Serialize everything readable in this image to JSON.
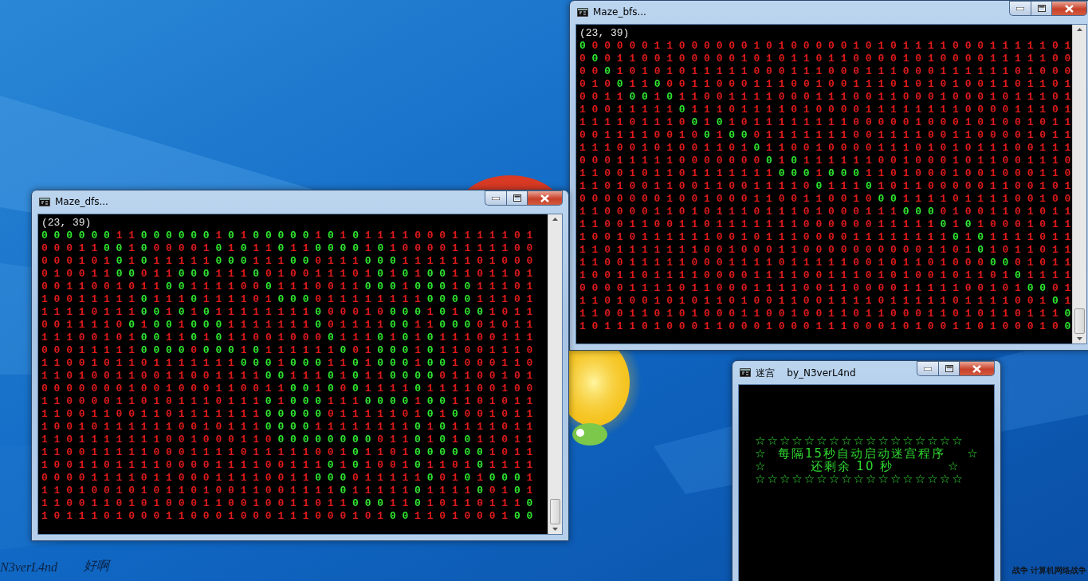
{
  "windows": [
    {
      "kind": "maze",
      "title": "Maze_bfs...",
      "header": "(23, 39)",
      "rows": [
        {
          "segments": [
            {
              "text": "0 ",
              "path": true
            },
            {
              "text": "0 0 0 0 0 1 1 0 0 0 0 0 0 1 0 1 0 0 0 0 0 1 0 1 0 1 1 1 1 0 0 0 1 1 1 1 1 0 1",
              "path": false
            }
          ]
        },
        {
          "segments": [
            {
              "text": "0 ",
              "path": false
            },
            {
              "text": "0 ",
              "path": true
            },
            {
              "text": "0 1 1 0 0 1 0 0 0 0 0 1 0 1 0 1 1 0 1 1 0 0 0 0 1 0 1 0 0 0 0 1 1 1 1 1 0 0",
              "path": false
            }
          ]
        },
        {
          "segments": [
            {
              "text": "0 0 ",
              "path": false
            },
            {
              "text": "0 ",
              "path": true
            },
            {
              "text": "1 0 1 0 1 0 1 1 1 1 1 0 0 0 1 1 1 0 0 0 1 1 1 0 0 0 1 1 1 1 1 1 0 1 0 0 0",
              "path": false
            }
          ]
        },
        {
          "segments": [
            {
              "text": "0 1 0 ",
              "path": false
            },
            {
              "text": "0 ",
              "path": true
            },
            {
              "text": "1 1 ",
              "path": false
            },
            {
              "text": "0 ",
              "path": true
            },
            {
              "text": "0 0 1 1 0 0 0 1 1 1 0 0 1 0 0 1 1 1 0 1 0 1 0 1 0 0 1 1 0 1 1 0 1",
              "path": false
            }
          ]
        },
        {
          "segments": [
            {
              "text": "0 0 1 1 ",
              "path": false
            },
            {
              "text": "0 0 ",
              "path": true
            },
            {
              "text": "1 ",
              "path": false
            },
            {
              "text": "0 ",
              "path": true
            },
            {
              "text": "1 1 0 0 1 1 1 1 0 0 0 1 1 1 0 0 1 1 0 0 0 1 0 0 0 1 0 1 1 1 0 1",
              "path": false
            }
          ]
        },
        {
          "segments": [
            {
              "text": "1 0 0 1 1 1 1 1 ",
              "path": false
            },
            {
              "text": "0 ",
              "path": true
            },
            {
              "text": "1 1 1 0 1 1 1 1 0 1 0 0 0 0 1 1 1 1 1 1 1 1 0 0 0 0 1 1 1 0 1",
              "path": false
            }
          ]
        },
        {
          "segments": [
            {
              "text": "1 1 1 1 0 1 1 1 0 ",
              "path": false
            },
            {
              "text": "0 ",
              "path": true
            },
            {
              "text": "1 ",
              "path": false
            },
            {
              "text": "0 ",
              "path": true
            },
            {
              "text": "1 0 1 1 1 1 1 1 1 1 0 0 0 0 0 1 0 0 0 1 0 1 0 0 1 0 1 1",
              "path": false
            }
          ]
        },
        {
          "segments": [
            {
              "text": "0 0 1 1 1 1 0 0 1 0 ",
              "path": false
            },
            {
              "text": "0 ",
              "path": true
            },
            {
              "text": "1 ",
              "path": false
            },
            {
              "text": "0 0 ",
              "path": true
            },
            {
              "text": "0 1 1 1 1 1 1 1 0 0 1 1 1 1 0 0 1 1 0 0 0 0 1 0 1 1",
              "path": false
            }
          ]
        },
        {
          "segments": [
            {
              "text": "1 1 1 0 0 1 0 1 0 0 1 1 0 1 ",
              "path": false
            },
            {
              "text": "0 ",
              "path": true
            },
            {
              "text": "1 1 0 0 1 0 0 0 0 1 1 1 0 1 0 1 0 1 1 1 0 0 1 1 1",
              "path": false
            }
          ]
        },
        {
          "segments": [
            {
              "text": "0 0 0 1 1 1 1 1 0 0 0 0 0 0 0 ",
              "path": false
            },
            {
              "text": "0 ",
              "path": true
            },
            {
              "text": "1 ",
              "path": false
            },
            {
              "text": "0 ",
              "path": true
            },
            {
              "text": "1 1 1 1 1 1 0 0 1 0 0 0 1 0 1 1 0 0 1 1 1 0",
              "path": false
            }
          ]
        },
        {
          "segments": [
            {
              "text": "1 1 0 0 1 0 1 1 0 1 1 1 1 1 1 1 ",
              "path": false
            },
            {
              "text": "0 0 0 ",
              "path": true
            },
            {
              "text": "1 ",
              "path": false
            },
            {
              "text": "0 0 0 ",
              "path": true
            },
            {
              "text": "1 1 0 1 0 0 0 1 0 0 1 0 0 0 1 1 0",
              "path": false
            }
          ]
        },
        {
          "segments": [
            {
              "text": "1 1 0 1 0 0 1 1 0 0 1 1 0 0 1 1 1 1 0 ",
              "path": false
            },
            {
              "text": "0 ",
              "path": true
            },
            {
              "text": "1 1 1 ",
              "path": false
            },
            {
              "text": "0 ",
              "path": true
            },
            {
              "text": "1 0 1 1 0 0 0 0 0 1 1 0 0 1 0 1",
              "path": false
            }
          ]
        },
        {
          "segments": [
            {
              "text": "0 0 0 0 0 0 0 1 0 0 1 0 0 0 1 1 0 0 1 1 0 0 1 0 ",
              "path": false
            },
            {
              "text": "0 0 ",
              "path": true
            },
            {
              "text": "1 1 1 1 0 1 1 1 1 0 0 1 0 0",
              "path": false
            }
          ]
        },
        {
          "segments": [
            {
              "text": "1 1 0 0 0 0 1 1 0 1 0 1 1 1 0 1 1 1 0 1 0 0 0 1 1 1 ",
              "path": false
            },
            {
              "text": "0 0 0 ",
              "path": true
            },
            {
              "text": "0 1 0 0 1 1 0 1 0 1 1",
              "path": false
            }
          ]
        },
        {
          "segments": [
            {
              "text": "1 1 0 0 1 1 0 0 1 1 0 1 1 1 1 1 1 1 0 0 0 0 0 0 1 1 1 1 1 ",
              "path": false
            },
            {
              "text": "0 ",
              "path": true
            },
            {
              "text": "1 ",
              "path": false
            },
            {
              "text": "0 ",
              "path": true
            },
            {
              "text": "1 0 0 0 1 0 1 1",
              "path": false
            }
          ]
        },
        {
          "segments": [
            {
              "text": "1 0 0 1 0 1 1 1 1 1 1 0 0 1 0 1 1 1 0 0 0 0 1 1 1 1 1 1 1 1 ",
              "path": false
            },
            {
              "text": "0 ",
              "path": true
            },
            {
              "text": "1 ",
              "path": false
            },
            {
              "text": "0 ",
              "path": true
            },
            {
              "text": "1 1 1 1 0 1 1",
              "path": false
            }
          ]
        },
        {
          "segments": [
            {
              "text": "1 1 0 1 1 1 1 1 1 1 0 0 1 0 0 0 1 1 0 0 0 0 0 0 0 0 0 0 1 1 0 1 ",
              "path": false
            },
            {
              "text": "0 ",
              "path": true
            },
            {
              "text": "1 0 1 1 0 1 1",
              "path": false
            }
          ]
        },
        {
          "segments": [
            {
              "text": "1 1 0 0 1 1 1 1 1 0 0 0 1 1 1 1 0 1 1 1 1 1 0 0 1 0 1 1 0 1 0 0 0 ",
              "path": false
            },
            {
              "text": "0 0 ",
              "path": true
            },
            {
              "text": "0 1 0 1 1",
              "path": false
            }
          ]
        },
        {
          "segments": [
            {
              "text": "1 0 0 1 1 0 1 1 1 1 0 0 0 0 1 1 1 1 0 0 1 1 1 0 1 0 1 0 0 1 0 1 1 0 1 ",
              "path": false
            },
            {
              "text": "0 ",
              "path": true
            },
            {
              "text": "1 1 1 1",
              "path": false
            }
          ]
        },
        {
          "segments": [
            {
              "text": "0 0 0 0 1 1 1 1 0 1 1 0 0 0 1 1 1 1 0 0 1 1 0 0 0 0 1 1 1 1 1 0 0 1 0 1 ",
              "path": false
            },
            {
              "text": "0 0 ",
              "path": true
            },
            {
              "text": "0 1",
              "path": false
            }
          ]
        },
        {
          "segments": [
            {
              "text": "1 1 0 1 0 0 1 0 1 0 1 1 0 1 0 0 1 1 0 0 1 1 1 1 0 1 1 1 1 1 0 1 1 1 1 0 0 1 ",
              "path": false
            },
            {
              "text": "0 ",
              "path": true
            },
            {
              "text": "1",
              "path": false
            }
          ]
        },
        {
          "segments": [
            {
              "text": "1 1 0 0 1 1 0 1 0 1 0 0 0 1 1 0 0 1 0 0 1 1 0 1 1 0 0 0 1 1 0 1 0 1 1 0 1 1 1 ",
              "path": false
            },
            {
              "text": "0",
              "path": true
            }
          ]
        },
        {
          "segments": [
            {
              "text": "1 0 1 1 1 0 1 0 0 0 1 1 0 0 0 1 0 0 0 1 1 1 0 0 0 1 0 1 0 0 1 1 0 1 0 0 0 1 0 ",
              "path": false
            },
            {
              "text": "0",
              "path": true
            }
          ]
        }
      ]
    },
    {
      "kind": "maze",
      "title": "Maze_dfs...",
      "header": "(23, 39)",
      "rows": [
        {
          "segments": [
            {
              "text": "0 0 0 0 0 0 ",
              "path": true
            },
            {
              "text": "1 1 ",
              "path": false
            },
            {
              "text": "0 0 0 0 0 0 ",
              "path": true
            },
            {
              "text": "1 ",
              "path": false
            },
            {
              "text": "0 ",
              "path": true
            },
            {
              "text": "1 ",
              "path": false
            },
            {
              "text": "0 0 0 0 0 ",
              "path": true
            },
            {
              "text": "1 ",
              "path": false
            },
            {
              "text": "0 ",
              "path": true
            },
            {
              "text": "1 ",
              "path": false
            },
            {
              "text": "0 ",
              "path": true
            },
            {
              "text": "1 1 1 1 0 0 0 1 1 1 1 1 0 1",
              "path": false
            }
          ]
        },
        {
          "segments": [
            {
              "text": "0 0 0 1 1 ",
              "path": false
            },
            {
              "text": "0 0 ",
              "path": true
            },
            {
              "text": "1 ",
              "path": false
            },
            {
              "text": "0 ",
              "path": true
            },
            {
              "text": "0 0 0 0 1 ",
              "path": false
            },
            {
              "text": "0 ",
              "path": true
            },
            {
              "text": "1 ",
              "path": false
            },
            {
              "text": "0 ",
              "path": true
            },
            {
              "text": "1 1 ",
              "path": false
            },
            {
              "text": "0 ",
              "path": true
            },
            {
              "text": "1 1 ",
              "path": false
            },
            {
              "text": "0 0 0 0 ",
              "path": true
            },
            {
              "text": "1 ",
              "path": false
            },
            {
              "text": "0 ",
              "path": true
            },
            {
              "text": "1 0 0 0 0 1 1 1 1 1 0 0",
              "path": false
            }
          ]
        },
        {
          "segments": [
            {
              "text": "0 0 0 1 0 1 ",
              "path": false
            },
            {
              "text": "0 ",
              "path": true
            },
            {
              "text": "1 ",
              "path": false
            },
            {
              "text": "0 ",
              "path": true
            },
            {
              "text": "1 1 1 1 1 ",
              "path": false
            },
            {
              "text": "0 0 0 ",
              "path": true
            },
            {
              "text": "1 1 1 ",
              "path": false
            },
            {
              "text": "0 0 ",
              "path": true
            },
            {
              "text": "0 1 1 1 ",
              "path": false
            },
            {
              "text": "0 0 0 ",
              "path": true
            },
            {
              "text": "1 1 1 1 1 1 0 1 0 0 0",
              "path": false
            }
          ]
        },
        {
          "segments": [
            {
              "text": "0 1 0 0 1 1 ",
              "path": false
            },
            {
              "text": "0 0 ",
              "path": true
            },
            {
              "text": "0 1 1 ",
              "path": false
            },
            {
              "text": "0 0 0 ",
              "path": true
            },
            {
              "text": "1 1 1 ",
              "path": false
            },
            {
              "text": "0 ",
              "path": true
            },
            {
              "text": "0 1 0 0 1 1 1 0 1 ",
              "path": false
            },
            {
              "text": "0 ",
              "path": true
            },
            {
              "text": "1 ",
              "path": false
            },
            {
              "text": "0 ",
              "path": true
            },
            {
              "text": "1 ",
              "path": false
            },
            {
              "text": "0 0 ",
              "path": true
            },
            {
              "text": "1 1 0 1 1 0 1",
              "path": false
            }
          ]
        },
        {
          "segments": [
            {
              "text": "0 0 1 1 0 0 1 0 1 1 ",
              "path": false
            },
            {
              "text": "0 0 ",
              "path": true
            },
            {
              "text": "1 1 1 1 0 0 ",
              "path": false
            },
            {
              "text": "0 ",
              "path": true
            },
            {
              "text": "1 1 1 0 0 1 1 ",
              "path": false
            },
            {
              "text": "0 0 0 ",
              "path": true
            },
            {
              "text": "1 ",
              "path": false
            },
            {
              "text": "0 0 0 ",
              "path": true
            },
            {
              "text": "1 ",
              "path": false
            },
            {
              "text": "0 ",
              "path": true
            },
            {
              "text": "1 1 1 0 1",
              "path": false
            }
          ]
        },
        {
          "segments": [
            {
              "text": "1 0 0 1 1 1 1 1 ",
              "path": false
            },
            {
              "text": "0 ",
              "path": true
            },
            {
              "text": "1 1 1 ",
              "path": false
            },
            {
              "text": "0 ",
              "path": true
            },
            {
              "text": "1 1 1 1 0 1 ",
              "path": false
            },
            {
              "text": "0 0 0 ",
              "path": true
            },
            {
              "text": "0 1 1 1 1 1 1 1 1 ",
              "path": false
            },
            {
              "text": "0 0 0 0 ",
              "path": true
            },
            {
              "text": "1 1 1 0 1",
              "path": false
            }
          ]
        },
        {
          "segments": [
            {
              "text": "1 1 1 1 0 1 1 1 ",
              "path": false
            },
            {
              "text": "0 0 ",
              "path": true
            },
            {
              "text": "1 ",
              "path": false
            },
            {
              "text": "0 ",
              "path": true
            },
            {
              "text": "1 ",
              "path": false
            },
            {
              "text": "0 ",
              "path": true
            },
            {
              "text": "1 1 1 1 1 1 1 1 ",
              "path": false
            },
            {
              "text": "0 ",
              "path": true
            },
            {
              "text": "0 0 0 1 0 ",
              "path": false
            },
            {
              "text": "0 0 0 ",
              "path": true
            },
            {
              "text": "1 ",
              "path": false
            },
            {
              "text": "0 ",
              "path": true
            },
            {
              "text": "1 ",
              "path": false
            },
            {
              "text": "0 0 ",
              "path": true
            },
            {
              "text": "1 0 1 1",
              "path": false
            }
          ]
        },
        {
          "segments": [
            {
              "text": "0 0 1 1 1 1 0 ",
              "path": false
            },
            {
              "text": "0 ",
              "path": true
            },
            {
              "text": "1 ",
              "path": false
            },
            {
              "text": "0 0 ",
              "path": true
            },
            {
              "text": "1 ",
              "path": false
            },
            {
              "text": "0 0 0 ",
              "path": true
            },
            {
              "text": "1 1 1 1 1 1 1 ",
              "path": false
            },
            {
              "text": "0 ",
              "path": true
            },
            {
              "text": "0 1 1 1 1 ",
              "path": false
            },
            {
              "text": "0 0 ",
              "path": true
            },
            {
              "text": "1 1 ",
              "path": false
            },
            {
              "text": "0 0 0 ",
              "path": true
            },
            {
              "text": "0 1 0 1 1",
              "path": false
            }
          ]
        },
        {
          "segments": [
            {
              "text": "1 1 1 0 0 1 0 1 ",
              "path": false
            },
            {
              "text": "0 0 ",
              "path": true
            },
            {
              "text": "1 1 ",
              "path": false
            },
            {
              "text": "0 ",
              "path": true
            },
            {
              "text": "1 ",
              "path": false
            },
            {
              "text": "0 ",
              "path": true
            },
            {
              "text": "1 1 0 0 1 0 0 0 ",
              "path": false
            },
            {
              "text": "0 ",
              "path": true
            },
            {
              "text": "1 1 1 ",
              "path": false
            },
            {
              "text": "0 ",
              "path": true
            },
            {
              "text": "1 ",
              "path": false
            },
            {
              "text": "0 ",
              "path": true
            },
            {
              "text": "1 ",
              "path": false
            },
            {
              "text": "0 ",
              "path": true
            },
            {
              "text": "1 1 1 0 0 1 1 1",
              "path": false
            }
          ]
        },
        {
          "segments": [
            {
              "text": "0 0 0 1 1 1 1 1 ",
              "path": false
            },
            {
              "text": "0 0 0 0 ",
              "path": true
            },
            {
              "text": "0 ",
              "path": false
            },
            {
              "text": "0 0 0 ",
              "path": true
            },
            {
              "text": "1 ",
              "path": false
            },
            {
              "text": "0 ",
              "path": true
            },
            {
              "text": "1 1 1 1 1 1 ",
              "path": false
            },
            {
              "text": "0 ",
              "path": true
            },
            {
              "text": "0 1 ",
              "path": false
            },
            {
              "text": "0 0 0 ",
              "path": true
            },
            {
              "text": "1 ",
              "path": false
            },
            {
              "text": "0 ",
              "path": true
            },
            {
              "text": "1 1 0 0 1 1 1 0",
              "path": false
            }
          ]
        },
        {
          "segments": [
            {
              "text": "1 1 0 0 1 0 1 1 0 1 1 1 1 1 1 1 ",
              "path": false
            },
            {
              "text": "0 0 0 ",
              "path": true
            },
            {
              "text": "1 ",
              "path": false
            },
            {
              "text": "0 0 0 ",
              "path": true
            },
            {
              "text": "1 1 ",
              "path": false
            },
            {
              "text": "0 ",
              "path": true
            },
            {
              "text": "1 ",
              "path": false
            },
            {
              "text": "0 0 0 ",
              "path": true
            },
            {
              "text": "1 ",
              "path": false
            },
            {
              "text": "0 0 ",
              "path": true
            },
            {
              "text": "1 0 0 0 1 1 0",
              "path": false
            }
          ]
        },
        {
          "segments": [
            {
              "text": "1 1 0 1 0 0 1 1 0 0 1 1 0 0 1 1 1 1 ",
              "path": false
            },
            {
              "text": "0 0 ",
              "path": true
            },
            {
              "text": "1 1 1 ",
              "path": false
            },
            {
              "text": "0 ",
              "path": true
            },
            {
              "text": "1 ",
              "path": false
            },
            {
              "text": "0 ",
              "path": true
            },
            {
              "text": "1 1 ",
              "path": false
            },
            {
              "text": "0 0 0 0 ",
              "path": true
            },
            {
              "text": "0 1 1 0 0 1 0 1",
              "path": false
            }
          ]
        },
        {
          "segments": [
            {
              "text": "0 0 0 0 0 0 0 1 0 0 1 0 0 0 1 1 0 0 1 1 ",
              "path": false
            },
            {
              "text": "0 0 ",
              "path": true
            },
            {
              "text": "1 ",
              "path": false
            },
            {
              "text": "0 ",
              "path": true
            },
            {
              "text": "0 ",
              "path": false
            },
            {
              "text": "0 ",
              "path": true
            },
            {
              "text": "1 1 1 1 ",
              "path": false
            },
            {
              "text": "0 ",
              "path": true
            },
            {
              "text": "1 1 1 1 0 0 1 0 0",
              "path": false
            }
          ]
        },
        {
          "segments": [
            {
              "text": "1 1 0 0 0 0 1 1 0 1 0 1 1 1 0 1 1 1 ",
              "path": false
            },
            {
              "text": "0 ",
              "path": true
            },
            {
              "text": "1 ",
              "path": false
            },
            {
              "text": "0 0 0 ",
              "path": true
            },
            {
              "text": "1 1 1 ",
              "path": false
            },
            {
              "text": "0 0 0 0 ",
              "path": true
            },
            {
              "text": "1 ",
              "path": false
            },
            {
              "text": "0 0 ",
              "path": true
            },
            {
              "text": "1 1 0 1 0 1 1",
              "path": false
            }
          ]
        },
        {
          "segments": [
            {
              "text": "1 1 0 0 1 1 0 0 1 1 0 1 1 1 1 1 1 1 ",
              "path": false
            },
            {
              "text": "0 0 0 0 0 ",
              "path": true
            },
            {
              "text": "0 1 1 1 1 1 0 1 ",
              "path": false
            },
            {
              "text": "0 ",
              "path": true
            },
            {
              "text": "1 ",
              "path": false
            },
            {
              "text": "0 ",
              "path": true
            },
            {
              "text": "0 0 1 0 1 1",
              "path": false
            }
          ]
        },
        {
          "segments": [
            {
              "text": "1 0 0 1 0 1 1 1 1 1 1 0 0 1 0 1 1 1 ",
              "path": false
            },
            {
              "text": "0 0 0 0 ",
              "path": true
            },
            {
              "text": "1 1 1 1 1 1 1 1 ",
              "path": false
            },
            {
              "text": "0 ",
              "path": true
            },
            {
              "text": "1 ",
              "path": false
            },
            {
              "text": "0 ",
              "path": true
            },
            {
              "text": "1 1 1 1 0 1 1",
              "path": false
            }
          ]
        },
        {
          "segments": [
            {
              "text": "1 1 0 1 1 1 1 1 1 1 0 0 1 0 0 0 1 1 0 ",
              "path": false
            },
            {
              "text": "0 0 0 0 0 0 0 0 ",
              "path": true
            },
            {
              "text": "0 1 1 ",
              "path": false
            },
            {
              "text": "0 ",
              "path": true
            },
            {
              "text": "1 ",
              "path": false
            },
            {
              "text": "0 ",
              "path": true
            },
            {
              "text": "1 ",
              "path": false
            },
            {
              "text": "0 ",
              "path": true
            },
            {
              "text": "1 1 0 1 1",
              "path": false
            }
          ]
        },
        {
          "segments": [
            {
              "text": "1 1 0 0 1 1 1 1 1 0 0 0 1 1 1 1 0 1 1 1 1 1 0 0 1 ",
              "path": false
            },
            {
              "text": "0 ",
              "path": true
            },
            {
              "text": "1 1 0 1 ",
              "path": false
            },
            {
              "text": "0 0 0 0 0 0 ",
              "path": true
            },
            {
              "text": "1 0 1 1",
              "path": false
            }
          ]
        },
        {
          "segments": [
            {
              "text": "1 0 0 1 1 0 1 1 1 1 0 0 0 0 1 1 1 1 0 0 1 1 1 ",
              "path": false
            },
            {
              "text": "0 ",
              "path": true
            },
            {
              "text": "1 ",
              "path": false
            },
            {
              "text": "0 ",
              "path": true
            },
            {
              "text": "1 0 0 1 ",
              "path": false
            },
            {
              "text": "0 ",
              "path": true
            },
            {
              "text": "1 1 0 1 ",
              "path": false
            },
            {
              "text": "0 ",
              "path": true
            },
            {
              "text": "1 1 1 1",
              "path": false
            }
          ]
        },
        {
          "segments": [
            {
              "text": "0 0 0 0 1 1 1 1 0 1 1 0 0 0 1 1 1 1 0 0 1 1 ",
              "path": false
            },
            {
              "text": "0 0 0 ",
              "path": true
            },
            {
              "text": "0 1 1 1 1 1 ",
              "path": false
            },
            {
              "text": "0 ",
              "path": true
            },
            {
              "text": "0 1 ",
              "path": false
            },
            {
              "text": "0 ",
              "path": true
            },
            {
              "text": "1 ",
              "path": false
            },
            {
              "text": "0 0 0 ",
              "path": true
            },
            {
              "text": "1",
              "path": false
            }
          ]
        },
        {
          "segments": [
            {
              "text": "1 1 0 1 0 0 1 0 1 0 1 1 0 1 0 0 1 1 0 0 1 1 1 1 ",
              "path": false
            },
            {
              "text": "0 ",
              "path": true
            },
            {
              "text": "1 1 1 1 1 ",
              "path": false
            },
            {
              "text": "0 ",
              "path": true
            },
            {
              "text": "1 1 1 1 ",
              "path": false
            },
            {
              "text": "0 ",
              "path": true
            },
            {
              "text": "0 1 ",
              "path": false
            },
            {
              "text": "0 ",
              "path": true
            },
            {
              "text": "1",
              "path": false
            }
          ]
        },
        {
          "segments": [
            {
              "text": "1 1 0 0 1 1 0 1 0 1 0 0 0 1 1 0 0 1 0 0 1 1 0 1 1 ",
              "path": false
            },
            {
              "text": "0 0 0 ",
              "path": true
            },
            {
              "text": "1 1 ",
              "path": false
            },
            {
              "text": "0 ",
              "path": true
            },
            {
              "text": "1 0 1 1 0 1 1 1 ",
              "path": false
            },
            {
              "text": "0",
              "path": true
            }
          ]
        },
        {
          "segments": [
            {
              "text": "1 0 1 1 1 0 1 0 0 0 1 1 0 0 0 1 0 0 0 1 1 1 0 0 0 1 0 1 ",
              "path": false
            },
            {
              "text": "0 0 ",
              "path": true
            },
            {
              "text": "1 1 0 1 0 0 0 1 ",
              "path": false
            },
            {
              "text": "0 0",
              "path": true
            }
          ]
        }
      ]
    },
    {
      "kind": "message",
      "title": "迷宫    by_N3verL4nd",
      "lines": [
        "☆☆☆☆☆☆☆☆☆☆☆☆☆☆☆☆☆",
        "☆  每隔15秒自动启动迷宫程序    ☆",
        "☆        还剩余 10 秒          ☆",
        "☆☆☆☆☆☆☆☆☆☆☆☆☆☆☆☆☆"
      ]
    }
  ],
  "desktop": {
    "signature": [
      "N3verL4nd",
      "好啊"
    ],
    "icon_label": "战争 计算机网络战争"
  }
}
